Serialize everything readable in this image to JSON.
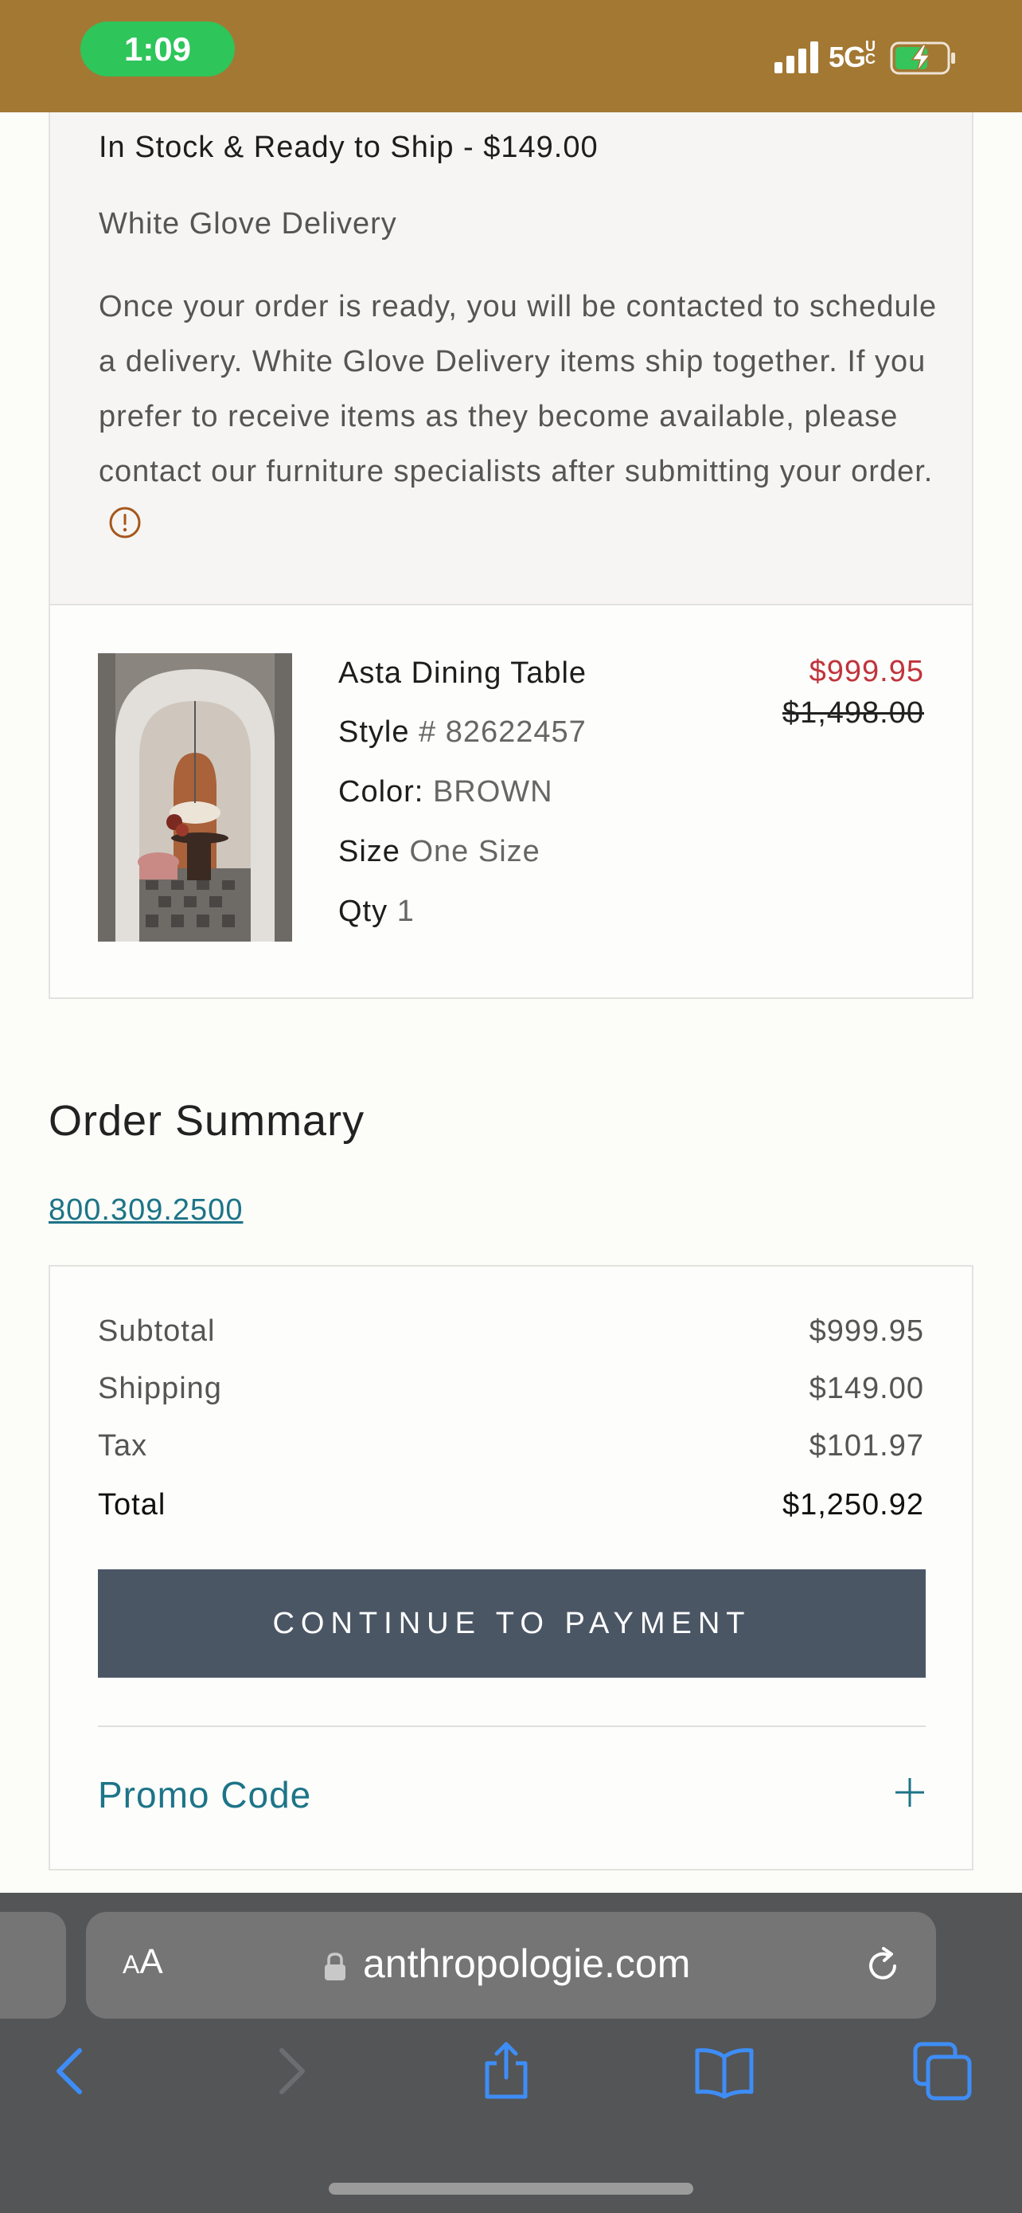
{
  "status_bar": {
    "time": "1:09",
    "network": "5G",
    "network_suffix": "UC",
    "background_color": "#a37833",
    "time_pill_color": "#2ec55b"
  },
  "shipping": {
    "title": "In Stock & Ready to Ship - $149.00",
    "method": "White Glove Delivery",
    "note": "Once your order is ready, you will be contacted to schedule a delivery. White Glove Delivery items ship together. If you prefer to receive items as they become available, please contact our furniture specialists after submitting your order.",
    "info_icon": "info-circle-icon"
  },
  "item": {
    "name": "Asta Dining Table",
    "style_label": "Style",
    "style_value": "# 82622457",
    "color_label": "Color:",
    "color_value": "BROWN",
    "size_label": "Size",
    "size_value": "One Size",
    "qty_label": "Qty",
    "qty_value": "1",
    "sale_price": "$999.95",
    "original_price": "$1,498.00",
    "sale_color": "#c0343c"
  },
  "summary": {
    "title": "Order Summary",
    "phone": "800.309.2500",
    "subtotal_label": "Subtotal",
    "subtotal_value": "$999.95",
    "shipping_label": "Shipping",
    "shipping_value": "$149.00",
    "tax_label": "Tax",
    "tax_value": "$101.97",
    "total_label": "Total",
    "total_value": "$1,250.92",
    "continue_button": "CONTINUE TO PAYMENT",
    "promo_label": "Promo Code",
    "accent_color": "#1d7488",
    "button_color": "#4b5665"
  },
  "browser": {
    "text_size_big": "A",
    "text_size_small": "A",
    "url": "anthropologie.com",
    "nav_icons": [
      "back-icon",
      "forward-icon",
      "share-icon",
      "bookmarks-icon",
      "tabs-icon"
    ]
  }
}
